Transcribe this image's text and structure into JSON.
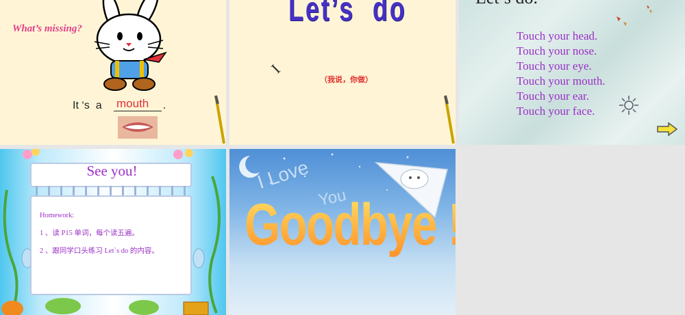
{
  "slides": {
    "s1": {
      "prompt": "What’s missing?",
      "sentence": "It ‘s  a",
      "answer": "mouth",
      "end_punct": "."
    },
    "s2": {
      "title": "Let’s  do",
      "pronoun": "I",
      "instruction": "（我说，你做）"
    },
    "s3": {
      "heading": "Let’s do.",
      "lines": [
        "Touch your head.",
        "Touch your nose.",
        "Touch your eye.",
        "Touch your mouth.",
        "Touch your ear.",
        "Touch your face."
      ]
    },
    "s4": {
      "title": "See you!",
      "homework_label": "Homework:",
      "items": [
        "1 、读 P15 单词，每个读五遍。",
        "2 、跟同学口头练习 Let`s do  的内容。"
      ]
    },
    "s5": {
      "bg_text_1": "I Love",
      "bg_text_2": "You",
      "title": "Goodbye !"
    }
  },
  "colors": {
    "pink_prompt": "#e0408a",
    "answer_red": "#e0303a",
    "title_blue": "#4530c4",
    "purple_text": "#9b2fc7"
  },
  "icons": [
    "rabbit-illustration",
    "pencil-icon",
    "lips-icon",
    "sun-icon",
    "next-arrow-icon",
    "flower-vine",
    "pumpkin",
    "moon-icon",
    "cat-on-paper-plane"
  ]
}
